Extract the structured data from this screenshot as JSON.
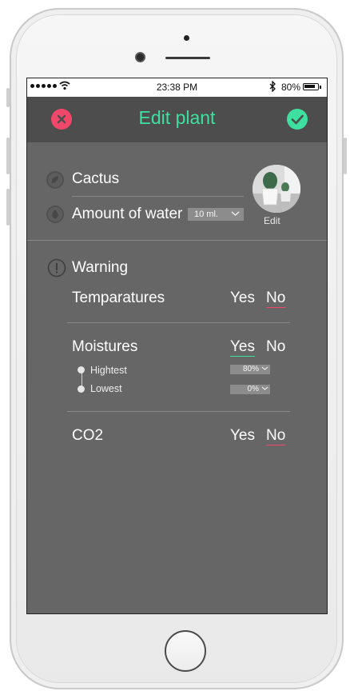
{
  "status_bar": {
    "time": "23:38 PM",
    "battery": "80%"
  },
  "header": {
    "title": "Edit plant"
  },
  "plant": {
    "name": "Cactus",
    "water_label": "Amount of water",
    "water_value": "10 ml.",
    "edit_label": "Edit"
  },
  "warning": {
    "label": "Warning",
    "rows": [
      {
        "label": "Temparatures",
        "yes": "Yes",
        "no": "No",
        "selected": "No"
      },
      {
        "label": "Moistures",
        "yes": "Yes",
        "no": "No",
        "selected": "Yes",
        "sub": [
          {
            "label": "Hightest",
            "value": "80%"
          },
          {
            "label": "Lowest",
            "value": "0%"
          }
        ]
      },
      {
        "label": "CO2",
        "yes": "Yes",
        "no": "No",
        "selected": "No"
      }
    ]
  },
  "colors": {
    "accent_green": "#3ee0a0",
    "accent_pink": "#f0486a",
    "screen_bg": "#666666",
    "header_bg": "#4d4d4d"
  }
}
